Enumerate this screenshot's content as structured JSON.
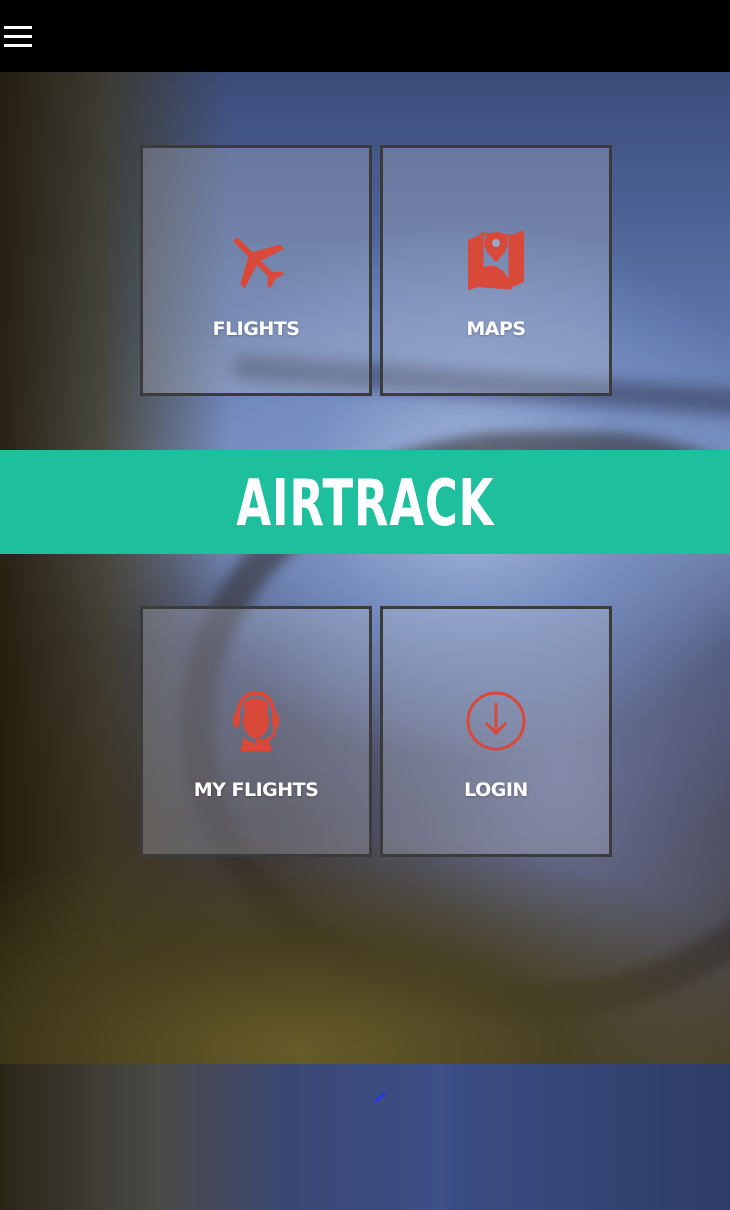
{
  "app": {
    "title": "AIRTRACK"
  },
  "topbar": {
    "menu_icon": "hamburger-menu-icon"
  },
  "tiles": [
    {
      "label": "FLIGHTS",
      "icon": "airplane-icon"
    },
    {
      "label": "MAPS",
      "icon": "map-pin-icon"
    },
    {
      "label": "MY FLIGHTS",
      "icon": "headset-agent-icon"
    },
    {
      "label": "LOGIN",
      "icon": "download-arrow-icon"
    }
  ],
  "colors": {
    "accent": "#1dbf9c",
    "icon": "#d9493a",
    "topbar": "#000000",
    "spinner": "#2b35e8"
  }
}
